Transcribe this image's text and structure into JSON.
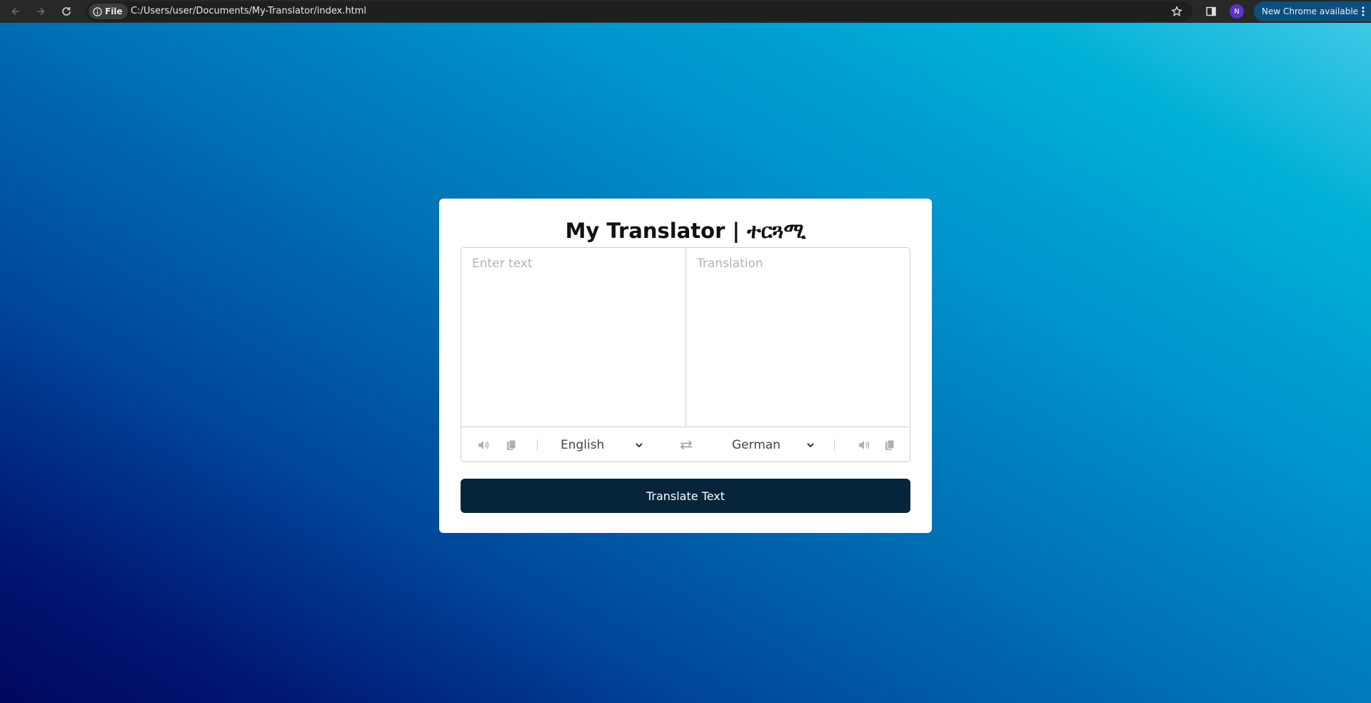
{
  "browser": {
    "site_chip_label": "File",
    "url": "C:/Users/user/Documents/My-Translator/index.html",
    "profile_initial": "N",
    "update_label": "New Chrome available"
  },
  "app": {
    "title": "My Translator | ተርጓሚ",
    "from_placeholder": "Enter text",
    "to_placeholder": "Translation",
    "from_language": "English",
    "to_language": "German",
    "translate_button": "Translate Text"
  },
  "colors": {
    "button_bg": "#06253a",
    "card_bg": "#ffffff",
    "icon_gray": "#b0b0b0"
  }
}
